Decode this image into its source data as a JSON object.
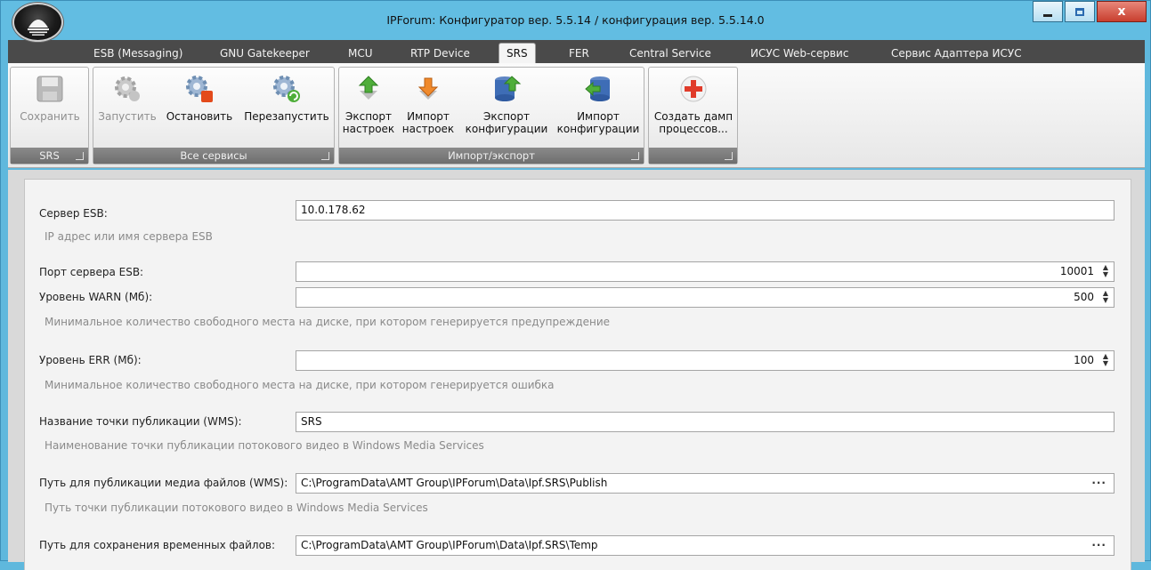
{
  "window": {
    "title": "IPForum: Конфигуратор вер. 5.5.14 / конфигурация вер. 5.5.14.0",
    "controls": {
      "minimize": "",
      "maximize": "",
      "close": "x"
    }
  },
  "tabs": [
    {
      "label": "ESB (Messaging)"
    },
    {
      "label": "GNU Gatekeeper"
    },
    {
      "label": "MCU"
    },
    {
      "label": "RTP Device"
    },
    {
      "label": "SRS",
      "active": true
    },
    {
      "label": "FER"
    },
    {
      "label": "Central Service"
    },
    {
      "label": "ИСУС Web-сервис"
    },
    {
      "label": "Сервис Адаптера ИСУС"
    }
  ],
  "ribbon": {
    "groups": [
      {
        "title": "SRS",
        "buttons": [
          {
            "label": "Сохранить",
            "icon": "save-icon",
            "enabled": false
          }
        ]
      },
      {
        "title": "Все сервисы",
        "buttons": [
          {
            "label": "Запустить",
            "icon": "gear-start-icon",
            "enabled": false
          },
          {
            "label": "Остановить",
            "icon": "gear-stop-icon",
            "enabled": true
          },
          {
            "label": "Перезапустить",
            "icon": "gear-restart-icon",
            "enabled": true
          }
        ]
      },
      {
        "title": "Импорт/экспорт",
        "buttons": [
          {
            "label_line1": "Экспорт",
            "label_line2": "настроек",
            "icon": "export-settings-icon"
          },
          {
            "label_line1": "Импорт",
            "label_line2": "настроек",
            "icon": "import-settings-icon"
          },
          {
            "label_line1": "Экспорт",
            "label_line2": "конфигурации",
            "icon": "export-config-icon"
          },
          {
            "label_line1": "Импорт",
            "label_line2": "конфигурации",
            "icon": "import-config-icon"
          }
        ]
      },
      {
        "title": "",
        "buttons": [
          {
            "label_line1": "Создать дамп",
            "label_line2": "процессов...",
            "icon": "dump-processes-icon"
          }
        ]
      }
    ]
  },
  "form": {
    "esb_server": {
      "label": "Сервер ESB:",
      "value": "10.0.178.62",
      "hint": "IP адрес или имя сервера ESB"
    },
    "esb_port": {
      "label": "Порт сервера ESB:",
      "value": "10001"
    },
    "warn_level": {
      "label": "Уровень WARN (Мб):",
      "value": "500",
      "hint": "Минимальное количество свободного места на диске, при котором генерируется предупреждение"
    },
    "err_level": {
      "label": "Уровень ERR (Мб):",
      "value": "100",
      "hint": "Минимальное количество свободного места на диске, при котором генерируется ошибка"
    },
    "wms_point": {
      "label": "Название точки публикации (WMS):",
      "value": "SRS",
      "hint": "Наименование точки публикации потокового видео в Windows Media Services"
    },
    "wms_path": {
      "label": "Путь для публикации медиа файлов (WMS):",
      "value": "C:\\ProgramData\\AMT Group\\IPForum\\Data\\Ipf.SRS\\Publish",
      "hint": "Путь точки публикации потокового видео в Windows Media Services",
      "browse": "···"
    },
    "temp_path": {
      "label": "Путь для сохранения временных файлов:",
      "value": "C:\\ProgramData\\AMT Group\\IPForum\\Data\\Ipf.SRS\\Temp",
      "browse": "···"
    }
  },
  "spinner": {
    "up": "▲",
    "down": "▼"
  }
}
